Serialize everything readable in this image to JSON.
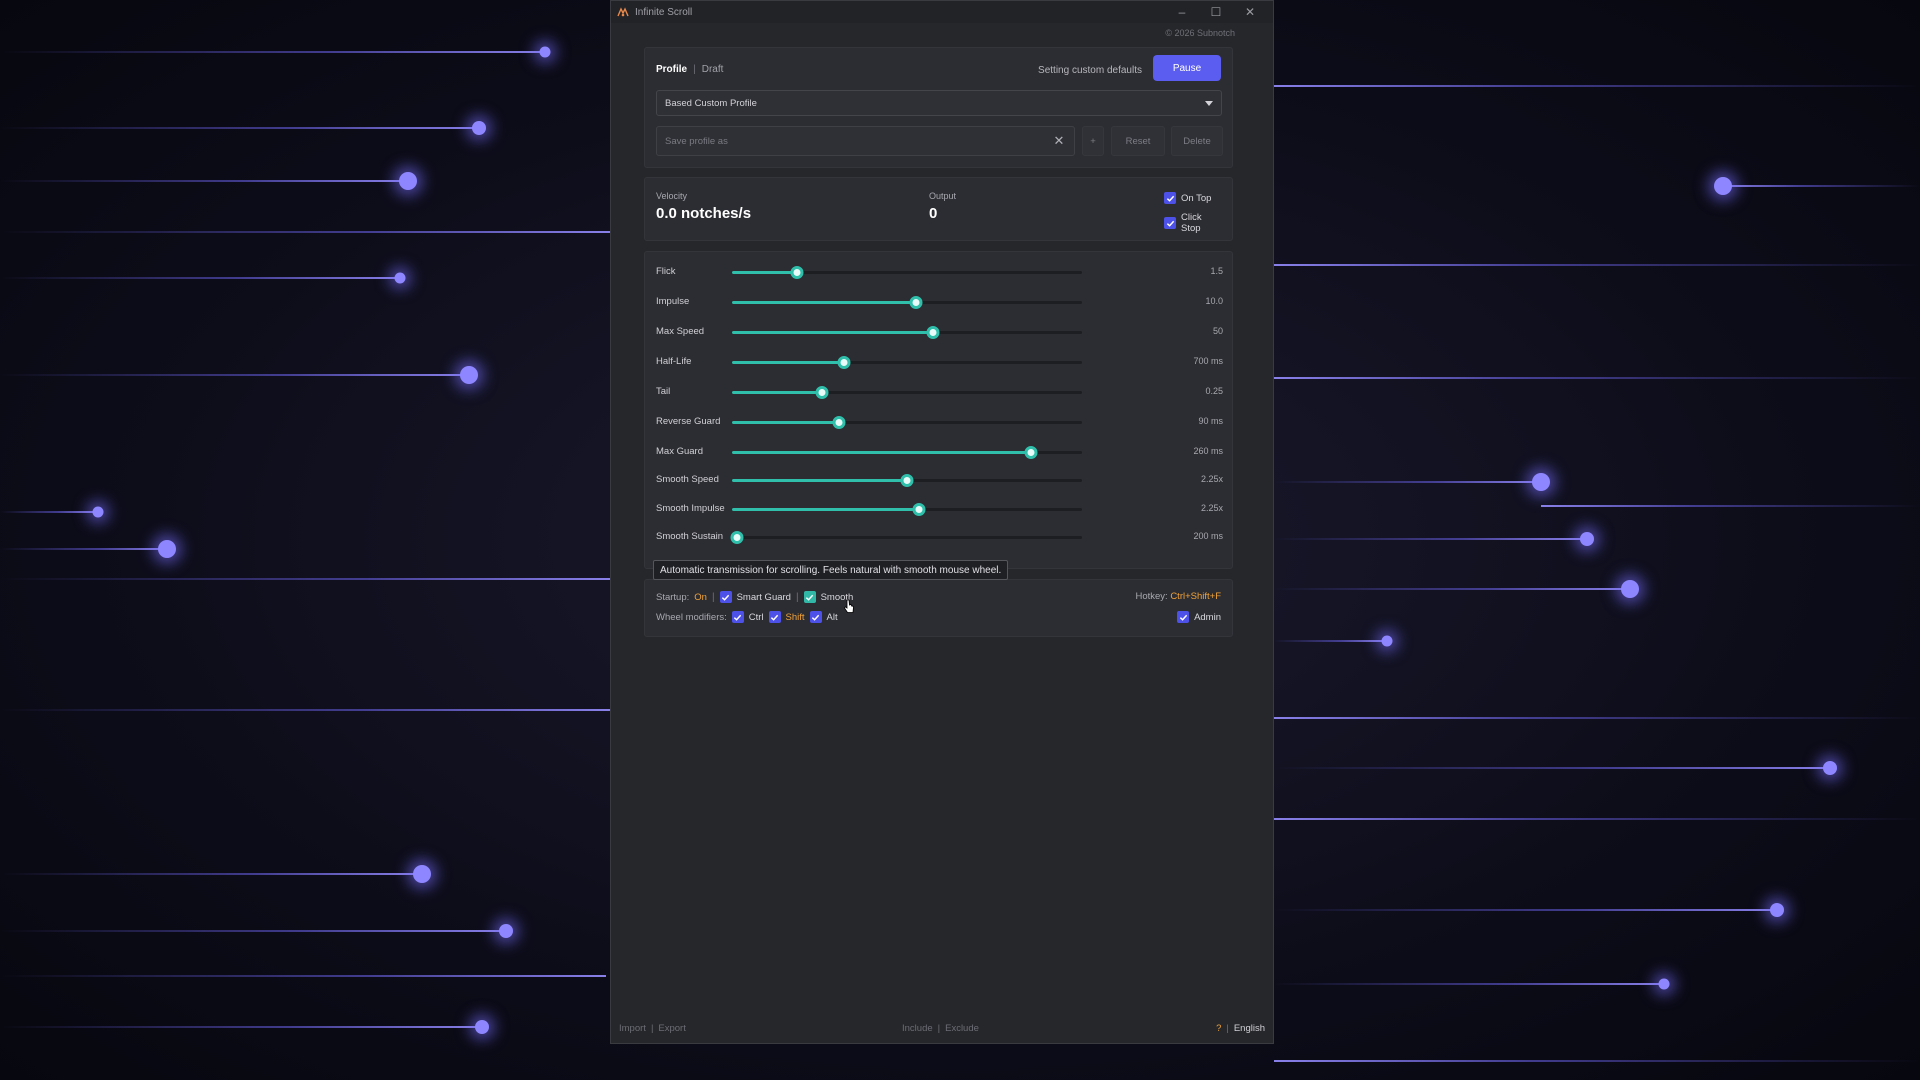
{
  "window": {
    "title": "Infinite Scroll",
    "copyright": "© 2026 Subnotch",
    "controls": {
      "minimize": "–",
      "maximize": "☐",
      "close": "✕"
    }
  },
  "profile": {
    "tabs": [
      {
        "label": "Profile",
        "active": true
      },
      {
        "label": "Draft",
        "active": false
      }
    ],
    "separator": "|",
    "status": "Setting custom defaults",
    "pause_label": "Pause",
    "selected_profile": "Based Custom Profile",
    "save_placeholder": "Save profile as",
    "save_value": "",
    "add_label": "+",
    "reset_label": "Reset",
    "delete_label": "Delete"
  },
  "metrics": {
    "velocity_label": "Velocity",
    "velocity_value": "0.0 notches/s",
    "output_label": "Output",
    "output_value": "0",
    "on_top_label": "On Top",
    "on_top_checked": true,
    "click_stop_label": "Click Stop",
    "click_stop_checked": true
  },
  "sliders": [
    {
      "label": "Flick",
      "value": "1.5",
      "fraction": 0.185
    },
    {
      "label": "Impulse",
      "value": "10.0",
      "fraction": 0.525
    },
    {
      "label": "Max Speed",
      "value": "50",
      "fraction": 0.575
    },
    {
      "label": "Half-Life",
      "value": "700 ms",
      "fraction": 0.32
    },
    {
      "label": "Tail",
      "value": "0.25",
      "fraction": 0.257
    },
    {
      "label": "Reverse Guard",
      "value": "90 ms",
      "fraction": 0.305
    },
    {
      "label": "Max Guard",
      "value": "260 ms",
      "fraction": 0.855
    },
    {
      "label": "Smooth Speed",
      "value": "2.25x",
      "fraction": 0.5
    },
    {
      "label": "Smooth Impulse",
      "value": "2.25x",
      "fraction": 0.533
    },
    {
      "label": "Smooth Sustain",
      "value": "200 ms",
      "fraction": 0.015
    }
  ],
  "tooltip": "Automatic transmission for scrolling. Feels natural with smooth mouse wheel.",
  "options": {
    "startup_label": "Startup:",
    "startup_value": "On",
    "smart_guard_label": "Smart Guard",
    "smooth_label": "Smooth",
    "wheel_mod_label": "Wheel modifiers:",
    "ctrl_label": "Ctrl",
    "shift_label": "Shift",
    "alt_label": "Alt",
    "hotkey_label": "Hotkey:",
    "hotkey_value": "Ctrl+Shift+F",
    "admin_label": "Admin"
  },
  "footer": {
    "import_label": "Import",
    "export_label": "Export",
    "include_label": "Include",
    "exclude_label": "Exclude",
    "help_label": "?",
    "language": "English"
  },
  "colors": {
    "accent": "#5b5cf0",
    "slider": "#2fbfab",
    "highlight": "#f2a33a"
  }
}
